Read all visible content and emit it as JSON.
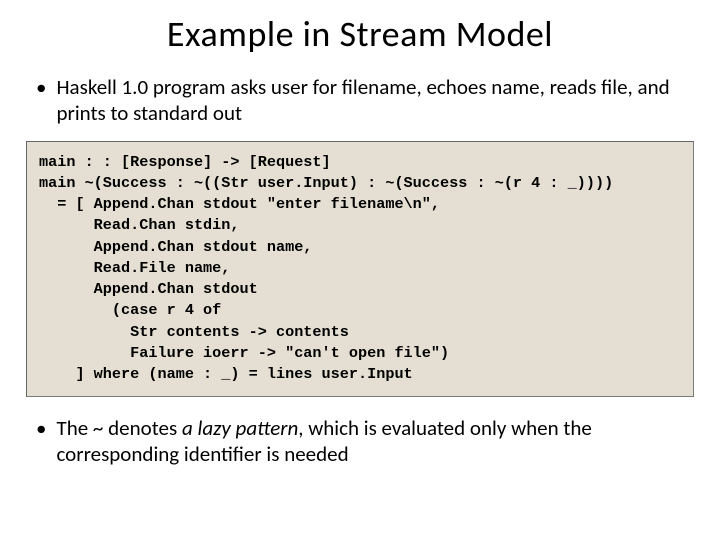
{
  "title": "Example in Stream Model",
  "bullets": {
    "b1": "Haskell 1.0 program asks user for filename, echoes name, reads file, and prints to standard out",
    "b2_pre": "The ~ denotes ",
    "b2_em": "a lazy pattern",
    "b2_post": ", which is evaluated only when the corresponding identifier is needed"
  },
  "code": "main : : [Response] -> [Request]\nmain ~(Success : ~((Str user.Input) : ~(Success : ~(r 4 : _))))\n  = [ Append.Chan stdout \"enter filename\\n\",\n      Read.Chan stdin,\n      Append.Chan stdout name,\n      Read.File name,\n      Append.Chan stdout\n        (case r 4 of\n          Str contents -> contents\n          Failure ioerr -> \"can't open file\")\n    ] where (name : _) = lines user.Input"
}
